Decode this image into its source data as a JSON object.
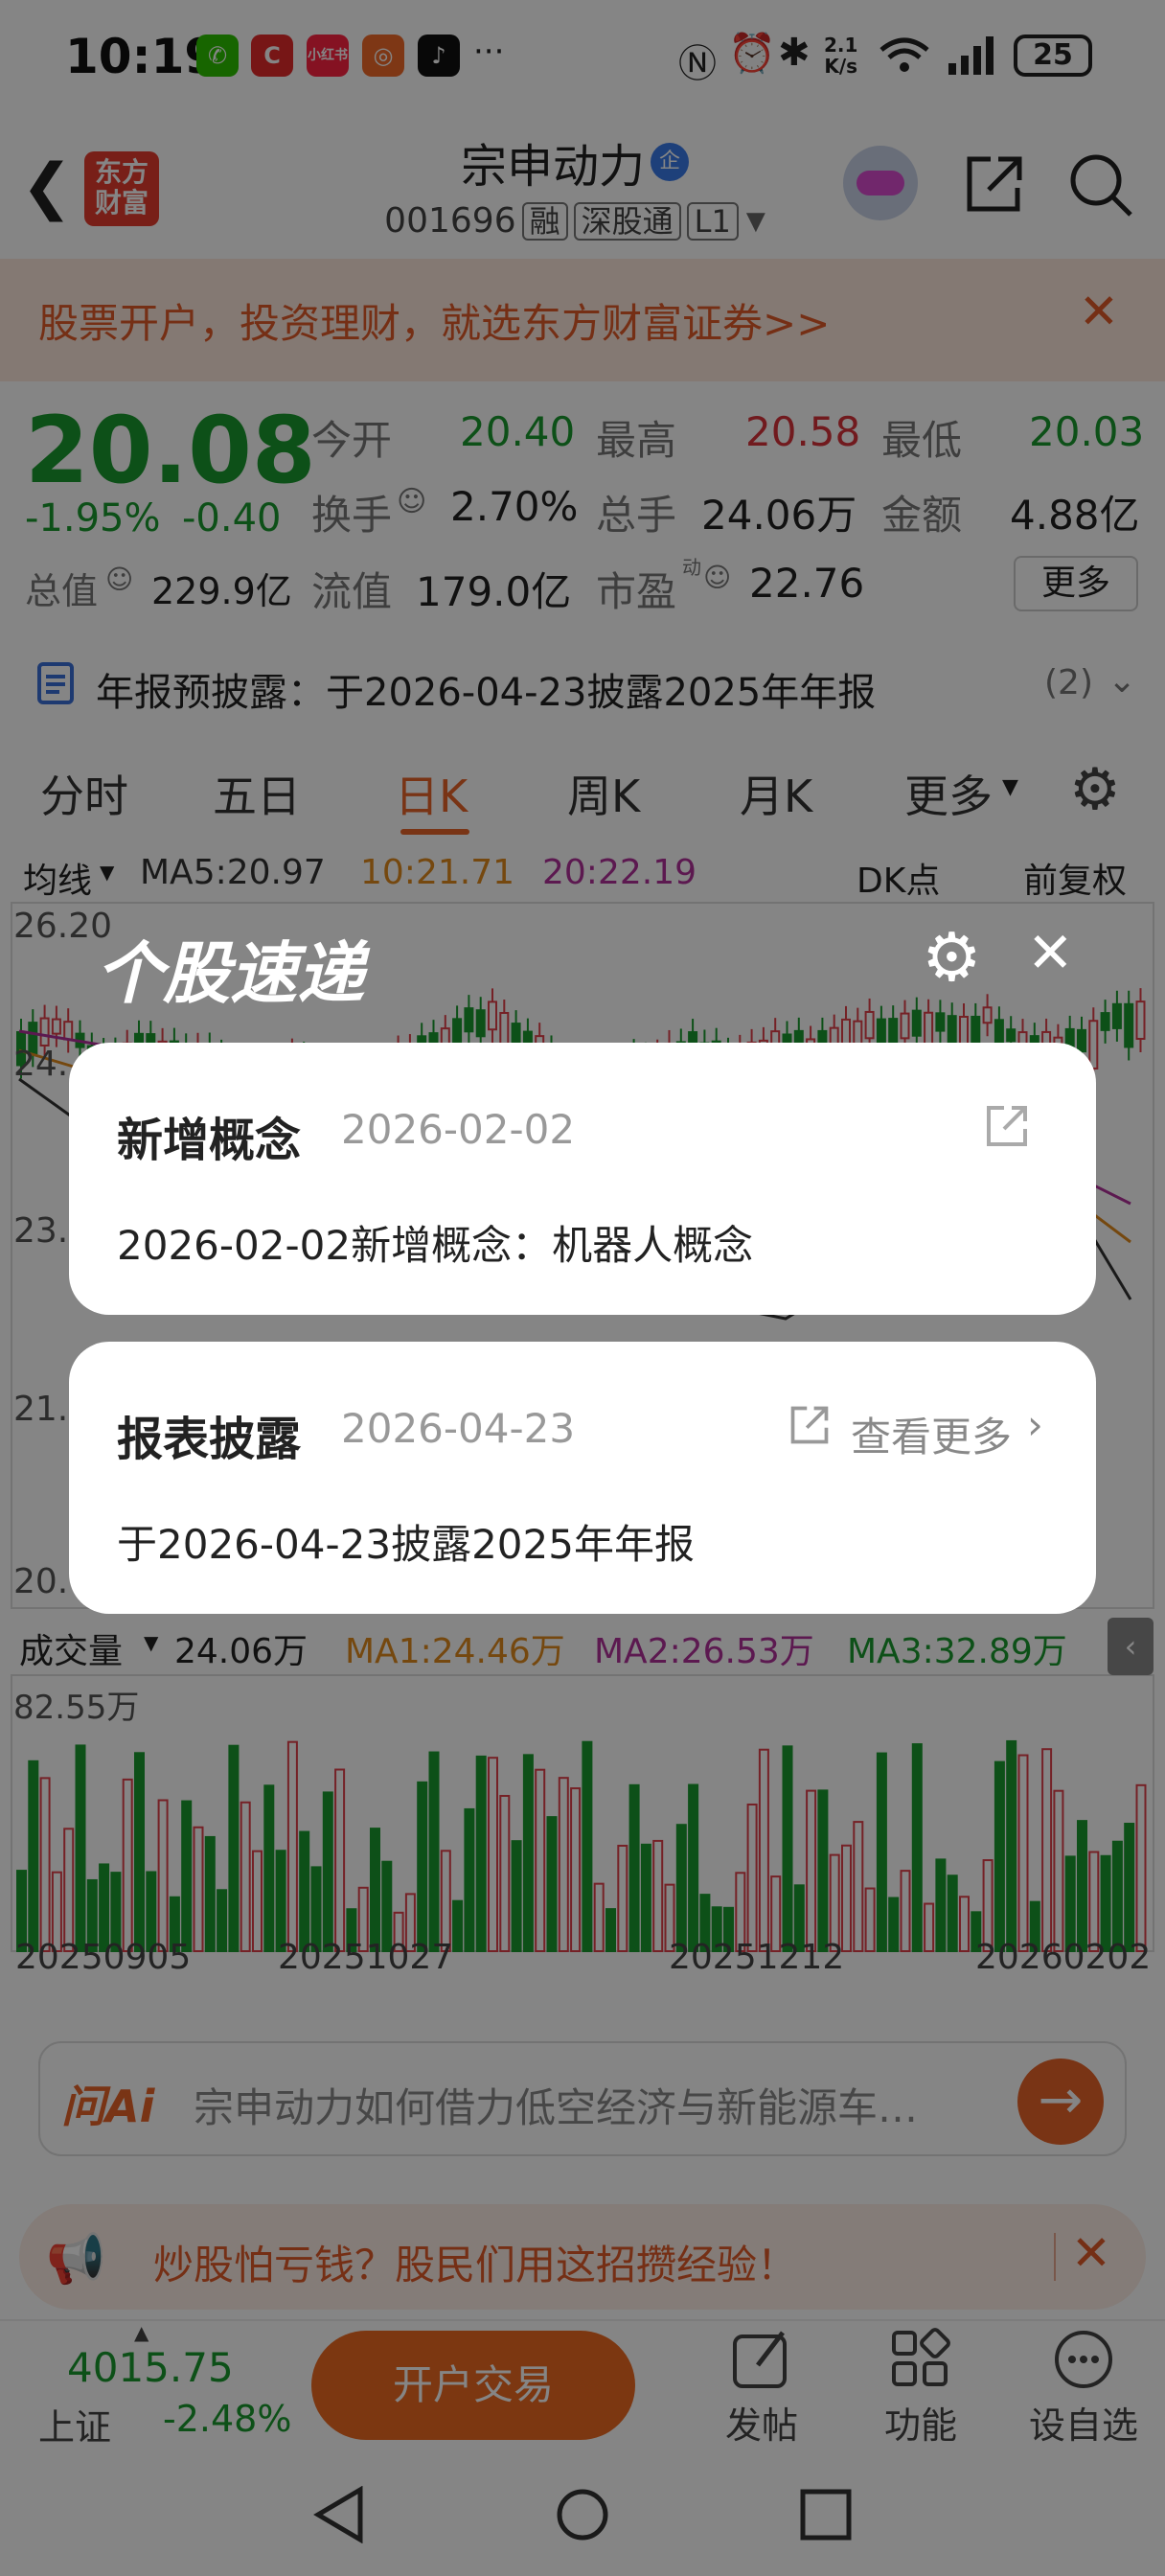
{
  "status_bar": {
    "time": "10:19",
    "more": "···",
    "battery": "25",
    "net_speed_top": "2.1",
    "net_speed_bottom": "K/s"
  },
  "header": {
    "logo_text_1": "东方",
    "logo_text_2": "财富",
    "stock_name": "宗申动力",
    "name_badge": "企",
    "stock_code": "001696",
    "tags": [
      "融",
      "深股通",
      "L1"
    ]
  },
  "banner": {
    "text": "股票开户，投资理财，就选东方财富证券>>"
  },
  "quote": {
    "price": "20.08",
    "change_pct": "-1.95%",
    "change": "-0.40",
    "open_label": "今开",
    "open": "20.40",
    "high_label": "最高",
    "high": "20.58",
    "low_label": "最低",
    "low": "20.03",
    "turnover_label": "换手",
    "turnover": "2.70%",
    "volume_label": "总手",
    "volume": "24.06万",
    "amount_label": "金额",
    "amount": "4.88亿",
    "mktcap_label": "总值",
    "mktcap": "229.9亿",
    "float_label": "流值",
    "float_cap": "179.0亿",
    "pe_label": "市盈",
    "pe_sup": "动",
    "pe": "22.76",
    "more_btn": "更多"
  },
  "notice": {
    "text": "年报预披露：于2026-04-23披露2025年年报",
    "count": "(2)"
  },
  "tabs": {
    "items": [
      "分时",
      "五日",
      "日K",
      "周K",
      "月K",
      "更多"
    ],
    "active": "日K"
  },
  "chart": {
    "ma_selector": "均线",
    "ma5": "MA5:20.97",
    "ma10": "10:21.71",
    "ma20": "20:22.19",
    "dk_btn": "DK点",
    "fq_btn": "前复权",
    "y_labels": [
      "26.20",
      "24.",
      "23.",
      "21.",
      "20."
    ],
    "vol_selector": "成交量",
    "vol_value": "24.06万",
    "vma1": "MA1:24.46万",
    "vma2": "MA2:26.53万",
    "vma3": "MA3:32.89万",
    "vol_max": "82.55万",
    "x_labels": [
      "20250905",
      "20251027",
      "20251212",
      "20260202"
    ],
    "colors": {
      "up": "#e0404a",
      "down": "#1a9a2e",
      "ma5": "#333333",
      "ma10": "#e08a1e",
      "ma20": "#b0309a"
    }
  },
  "ask_ai": {
    "logo": "问Ai",
    "placeholder": "宗申动力如何借力低空经济与新能源车…"
  },
  "promo": {
    "text": "炒股怕亏钱？股民们用这招攒经验！"
  },
  "bottom_bar": {
    "index_value": "4015.75",
    "index_name": "上证",
    "index_change": "-2.48%",
    "trade_btn": "开户交易",
    "post_label": "发帖",
    "func_label": "功能",
    "watch_label": "设自选"
  },
  "popup": {
    "title": "个股速递",
    "card1": {
      "title": "新增概念",
      "date": "2026-02-02",
      "body": "2026-02-02新增概念：机器人概念"
    },
    "card2": {
      "title": "报表披露",
      "date": "2026-04-23",
      "more": "查看更多",
      "body": "于2026-04-23披露2025年年报"
    }
  },
  "colors": {
    "accent": "#e8642a",
    "brand_red": "#e63c2e",
    "overlay": "rgba(0,0,0,0.48)"
  }
}
